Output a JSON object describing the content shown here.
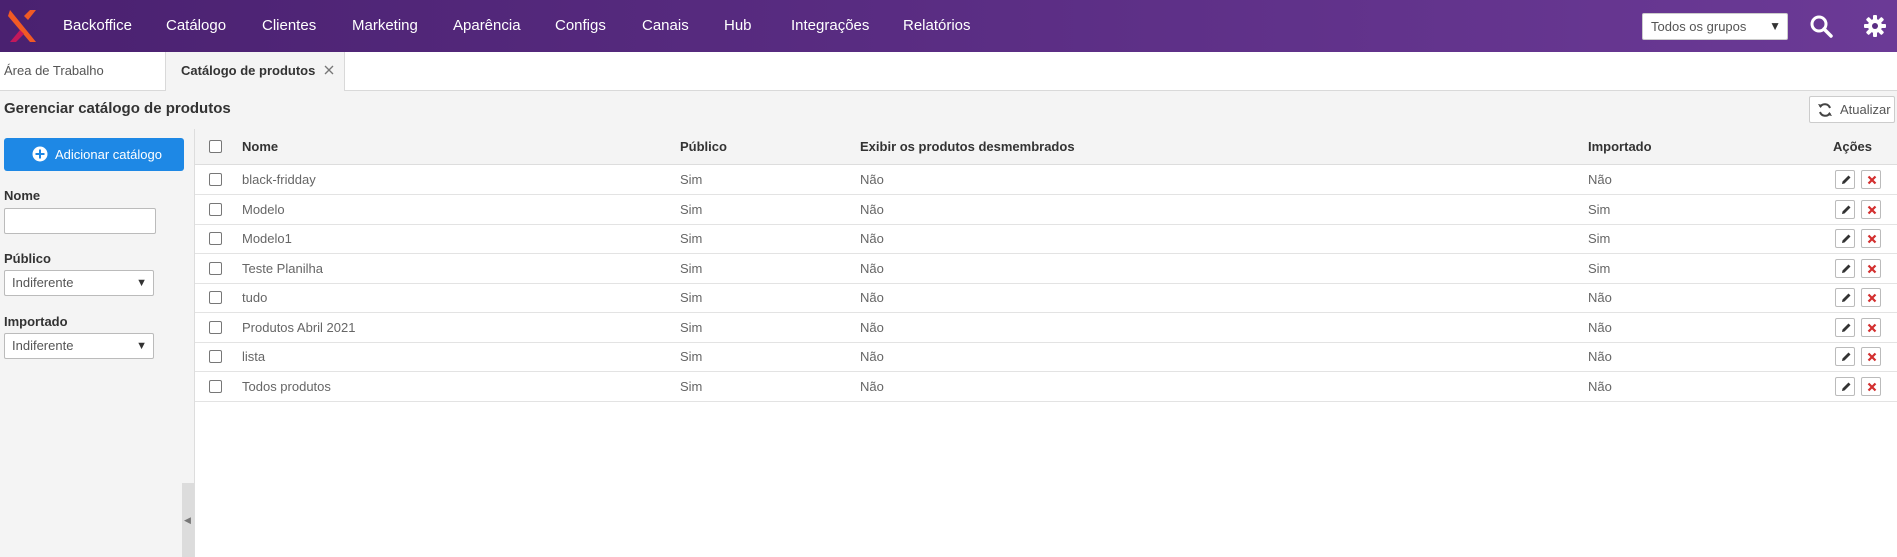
{
  "nav": {
    "items": [
      "Backoffice",
      "Catálogo",
      "Clientes",
      "Marketing",
      "Aparência",
      "Configs",
      "Canais",
      "Hub",
      "Integrações",
      "Relatórios"
    ],
    "group_select": "Todos os grupos",
    "icons": [
      "search-icon",
      "gear-icon"
    ]
  },
  "tabs": {
    "workspace": "Área de Trabalho",
    "active": "Catálogo de produtos"
  },
  "header": {
    "title": "Gerenciar catálogo de produtos",
    "refresh": "Atualizar"
  },
  "sidebar": {
    "add_button": "Adicionar catálogo",
    "name_label": "Nome",
    "name_value": "",
    "public_label": "Público",
    "public_value": "Indiferente",
    "imported_label": "Importado",
    "imported_value": "Indiferente"
  },
  "table": {
    "columns": [
      "Nome",
      "Público",
      "Exibir os produtos desmembrados",
      "Importado",
      "Ações"
    ],
    "rows": [
      {
        "nome": "black-fridday",
        "publico": "Sim",
        "exibir": "Não",
        "importado": "Não"
      },
      {
        "nome": "Modelo",
        "publico": "Sim",
        "exibir": "Não",
        "importado": "Sim"
      },
      {
        "nome": "Modelo1",
        "publico": "Sim",
        "exibir": "Não",
        "importado": "Sim"
      },
      {
        "nome": "Teste Planilha",
        "publico": "Sim",
        "exibir": "Não",
        "importado": "Sim"
      },
      {
        "nome": "tudo",
        "publico": "Sim",
        "exibir": "Não",
        "importado": "Não"
      },
      {
        "nome": "Produtos Abril 2021",
        "publico": "Sim",
        "exibir": "Não",
        "importado": "Não"
      },
      {
        "nome": "lista",
        "publico": "Sim",
        "exibir": "Não",
        "importado": "Não"
      },
      {
        "nome": "Todos produtos",
        "publico": "Sim",
        "exibir": "Não",
        "importado": "Não"
      }
    ]
  },
  "colors": {
    "nav_bg": "#5a2d83",
    "primary_button": "#1e88e5",
    "delete_icon": "#d32f2f",
    "logo": "#f15a24"
  }
}
